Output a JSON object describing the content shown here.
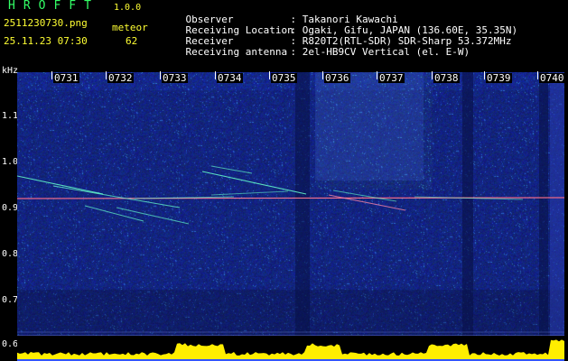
{
  "header": {
    "app_title": "HROFFT",
    "version": "1.0.0",
    "filename": "2511230730.png",
    "datetime": "25.11.23 07:30",
    "meteor_label": "meteor",
    "meteor_count": "62"
  },
  "info": {
    "observer_label": "Observer",
    "observer_value": ": Takanori Kawachi",
    "location_label": "Receiving Location",
    "location_value": ": Ogaki, Gifu, JAPAN (136.60E, 35.35N)",
    "receiver_label": "Receiver",
    "receiver_value": ": R820T2(RTL-SDR) SDR-Sharp 53.372MHz",
    "antenna_label": "Receiving antenna",
    "antenna_value": ": 2el-HB9CV Vertical (el. E-W)"
  },
  "spectrogram": {
    "unit": "kHz",
    "y_ticks": [
      "1.1",
      "1.0",
      "0.9",
      "0.8",
      "0.7",
      "0.6"
    ],
    "x_ticks": [
      "0731",
      "0732",
      "0733",
      "0734",
      "0735",
      "0736",
      "0737",
      "0738",
      "0739",
      "0740"
    ],
    "colors": {
      "background": "#0f1d7a",
      "carrier": "#ff4466",
      "trace": "#66ffcc",
      "envelope": "#ffee00"
    }
  }
}
